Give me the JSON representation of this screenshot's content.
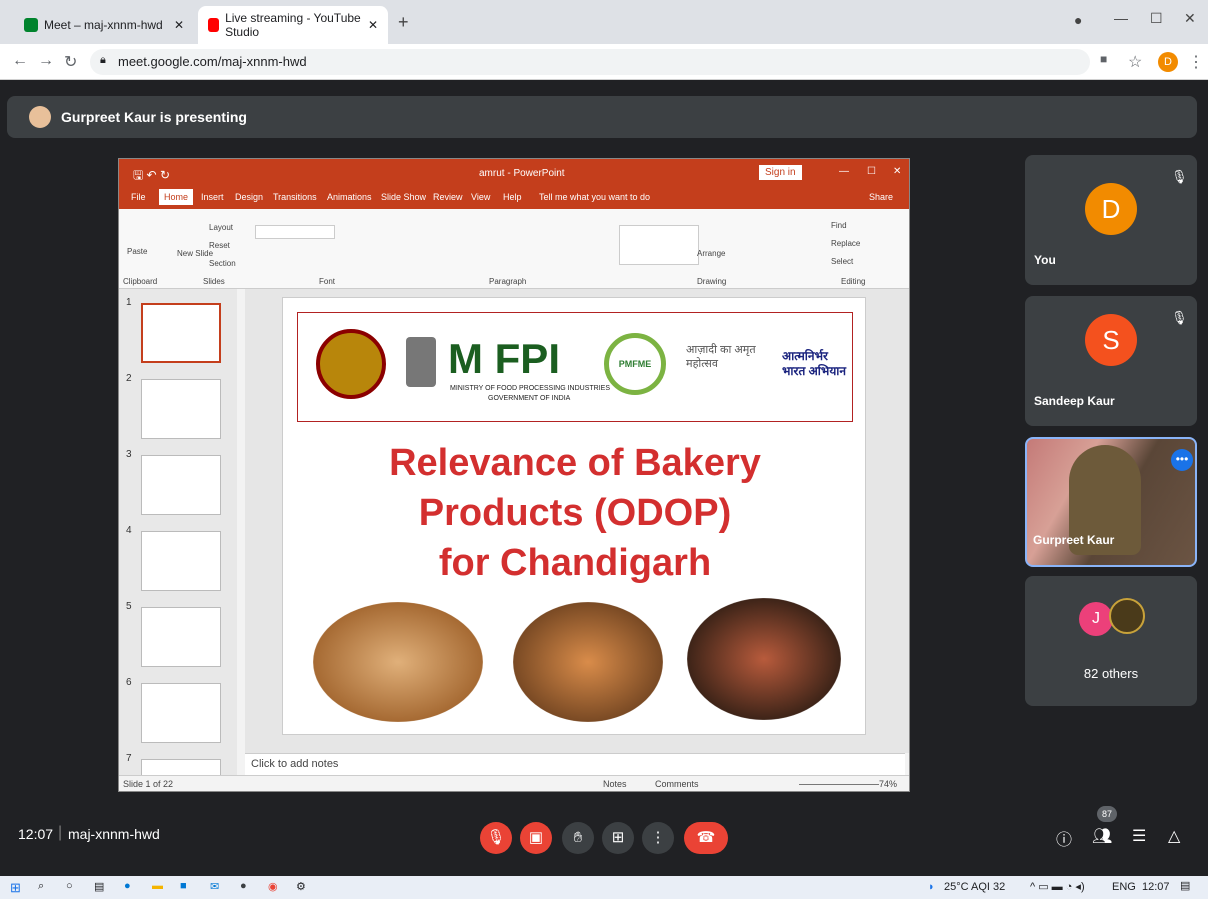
{
  "browser": {
    "tabs": [
      {
        "title": "Meet – maj-xnnm-hwd"
      },
      {
        "title": "Live streaming - YouTube Studio"
      }
    ],
    "url": "meet.google.com/maj-xnnm-hwd",
    "profile_initial": "D"
  },
  "meet": {
    "presenting_banner": "Gurpreet Kaur is presenting",
    "time": "12:07",
    "meeting_code": "maj-xnnm-hwd",
    "participants_badge": "87",
    "participants": [
      {
        "name": "You",
        "initial": "D",
        "color": "#f28b00"
      },
      {
        "name": "Sandeep Kaur",
        "initial": "S",
        "color": "#f4511e"
      },
      {
        "name": "Gurpreet Kaur"
      },
      {
        "name": "82 others",
        "initial": "J",
        "color": "#ec407a"
      }
    ]
  },
  "powerpoint": {
    "window_title": "amrut - PowerPoint",
    "sign_in": "Sign in",
    "share": "Share",
    "tell_me": "Tell me what you want to do",
    "ribbon_tabs": [
      "File",
      "Home",
      "Insert",
      "Design",
      "Transitions",
      "Animations",
      "Slide Show",
      "Review",
      "View",
      "Help"
    ],
    "groups": [
      "Clipboard",
      "Slides",
      "Font",
      "Paragraph",
      "Drawing",
      "Editing"
    ],
    "buttons": {
      "paste": "Paste",
      "new_slide": "New Slide",
      "layout": "Layout",
      "reset": "Reset",
      "section": "Section",
      "arrange": "Arrange",
      "find": "Find",
      "replace": "Replace",
      "select": "Select"
    },
    "thumb_numbers": [
      "1",
      "2",
      "3",
      "4",
      "5",
      "6",
      "7"
    ],
    "slide": {
      "title_lines": [
        "Relevance of  Bakery",
        "Products (ODOP)",
        "for Chandigarh"
      ],
      "logo_text": "M FPI",
      "ministry": "MINISTRY OF FOOD PROCESSING INDUSTRIES",
      "govt": "GOVERNMENT OF INDIA",
      "pmfme": "PMFME",
      "azadi": "आज़ादी का अमृत महोत्सव",
      "atmanirbhar": "आत्मनिर्भर भारत अभियान"
    },
    "notes_placeholder": "Click to add notes",
    "status": {
      "slide": "Slide 1 of 22",
      "notes": "Notes",
      "comments": "Comments",
      "zoom": "74%"
    }
  },
  "taskbar": {
    "weather": "25°C AQI 32",
    "lang": "ENG",
    "time": "12:07"
  }
}
